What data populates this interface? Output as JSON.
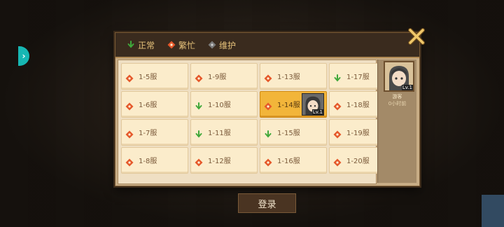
{
  "legend": [
    {
      "icon": "normal-status-icon",
      "label": "正常",
      "color": "#3fa83a"
    },
    {
      "icon": "busy-status-icon",
      "label": "繁忙",
      "color": "#e5582a"
    },
    {
      "icon": "maintenance-status-icon",
      "label": "维护",
      "color": "#7a7a7a"
    }
  ],
  "servers": [
    {
      "label": "1-5服",
      "status": "busy"
    },
    {
      "label": "1-9服",
      "status": "busy"
    },
    {
      "label": "1-13服",
      "status": "busy"
    },
    {
      "label": "1-17服",
      "status": "normal"
    },
    {
      "label": "1-6服",
      "status": "busy"
    },
    {
      "label": "1-10服",
      "status": "normal"
    },
    {
      "label": "1-14服",
      "status": "busy",
      "selected": true
    },
    {
      "label": "1-18服",
      "status": "busy"
    },
    {
      "label": "1-7服",
      "status": "busy"
    },
    {
      "label": "1-11服",
      "status": "normal"
    },
    {
      "label": "1-15服",
      "status": "normal"
    },
    {
      "label": "1-19服",
      "status": "busy"
    },
    {
      "label": "1-8服",
      "status": "busy"
    },
    {
      "label": "1-12服",
      "status": "busy"
    },
    {
      "label": "1-16服",
      "status": "busy"
    },
    {
      "label": "1-20服",
      "status": "busy"
    }
  ],
  "selected_server_avatar_level": "Lv.1",
  "profile": {
    "name": "游客",
    "time": "0小时前",
    "level": "Lv.1"
  },
  "login_label": "登录"
}
